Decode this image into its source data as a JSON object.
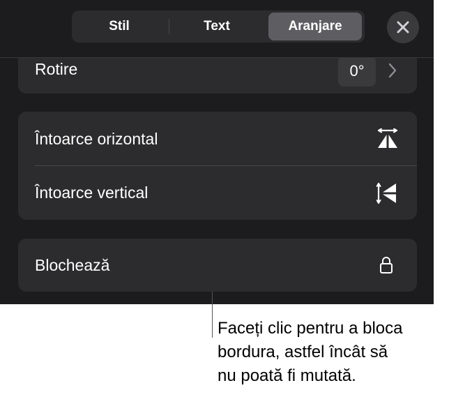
{
  "tabs": [
    {
      "label": "Stil",
      "active": false
    },
    {
      "label": "Text",
      "active": false
    },
    {
      "label": "Aranjare",
      "active": true
    }
  ],
  "rotation": {
    "label": "Rotire",
    "value": "0°"
  },
  "flip": {
    "horizontal_label": "Întoarce orizontal",
    "vertical_label": "Întoarce vertical"
  },
  "lock": {
    "label": "Blochează"
  },
  "callout": {
    "line1": "Faceți clic pentru a bloca",
    "line2": "bordura, astfel încât să",
    "line3": "nu poată fi mutată."
  },
  "colors": {
    "panel_bg": "#1c1c1e",
    "card_bg": "#2c2c2e",
    "active_tab": "#5e5e62",
    "text": "#ffffff",
    "secondary": "#8e8e93"
  },
  "icons": {
    "close": "close-icon",
    "chevron": "chevron-right-icon",
    "flip_h": "flip-horizontal-icon",
    "flip_v": "flip-vertical-icon",
    "lock": "lock-icon"
  }
}
